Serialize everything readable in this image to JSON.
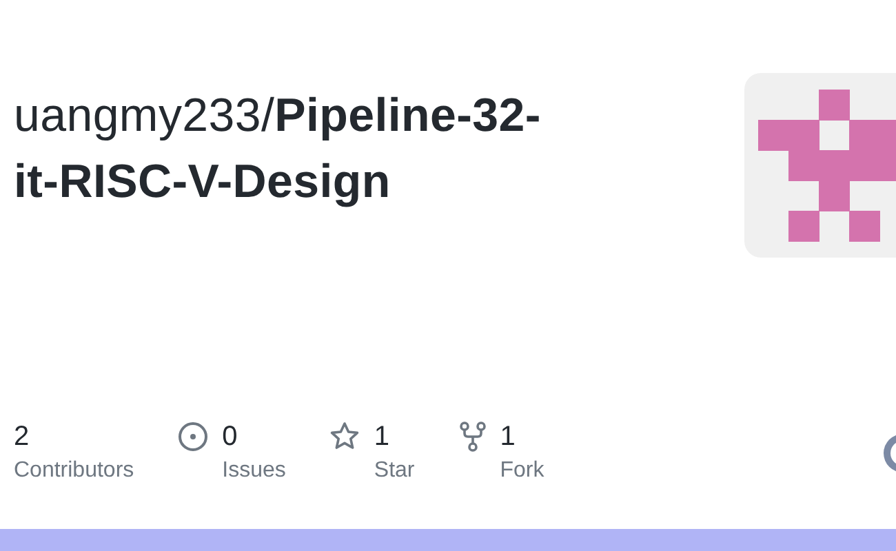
{
  "repo": {
    "owner": "uangmy233/",
    "name_line_1": "Pipeline-32-",
    "name_line_2": "it-RISC-V-Design"
  },
  "stats": [
    {
      "kind": "contributors",
      "count": "2",
      "label": "Contributors"
    },
    {
      "kind": "issues",
      "count": "0",
      "label": "Issues"
    },
    {
      "kind": "stars",
      "count": "1",
      "label": "Star"
    },
    {
      "kind": "forks",
      "count": "1",
      "label": "Fork"
    }
  ]
}
